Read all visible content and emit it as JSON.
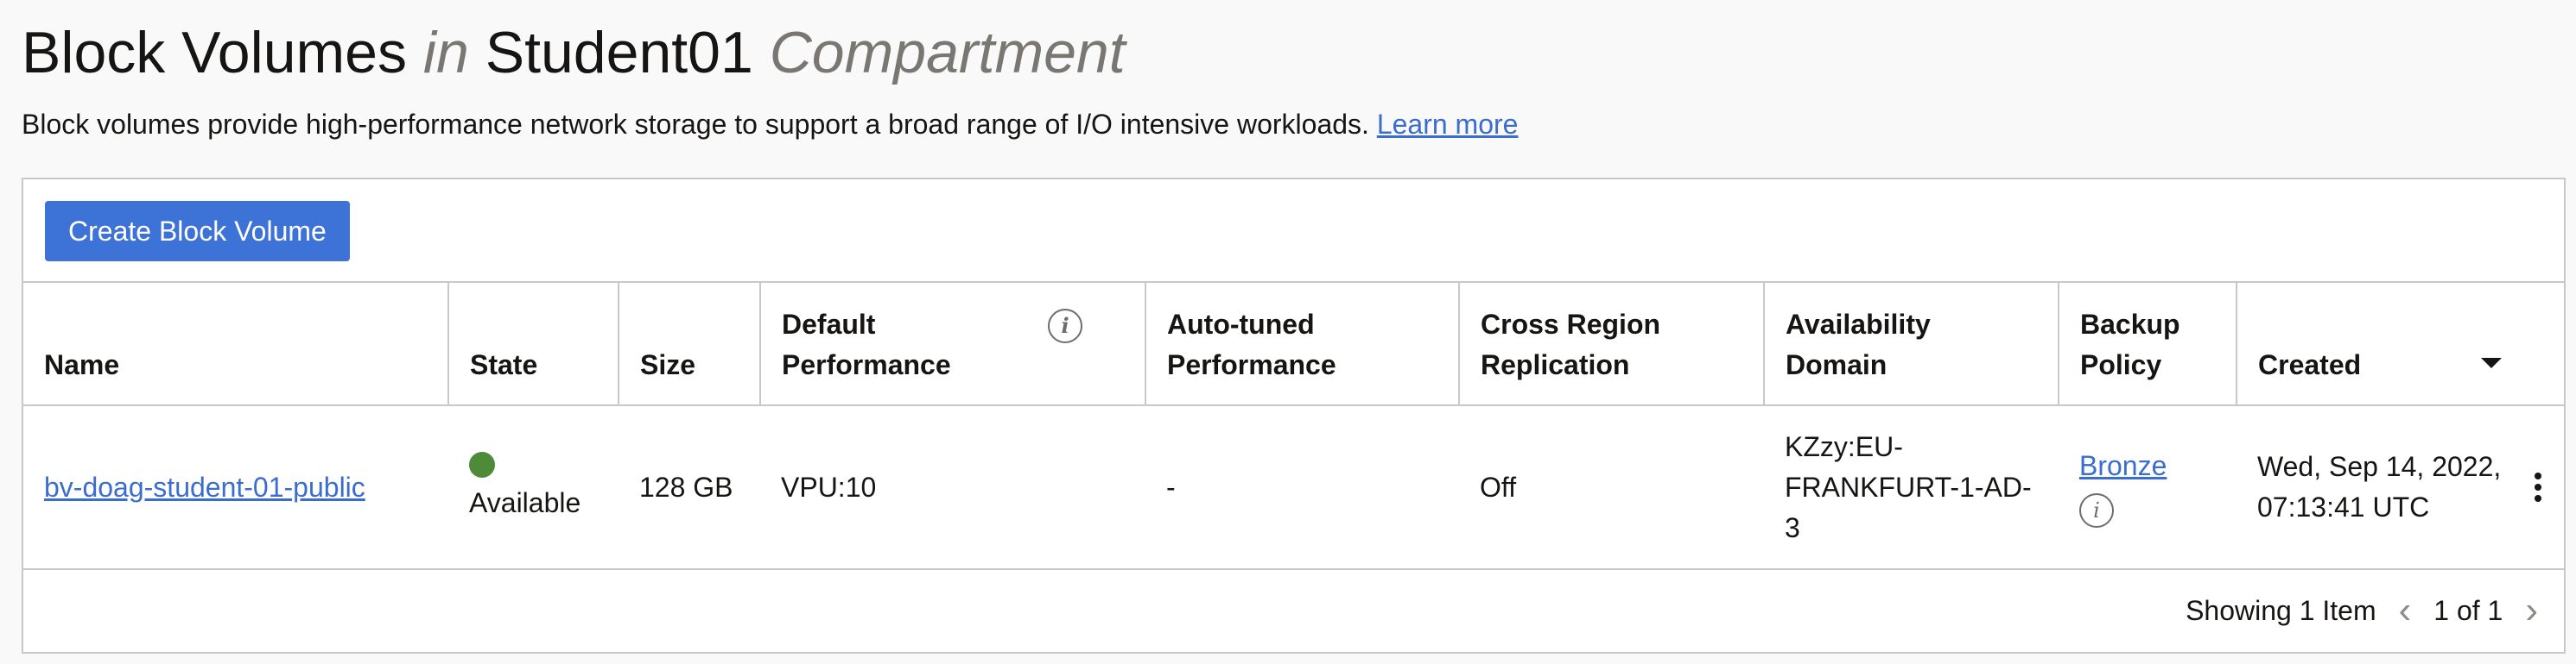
{
  "header": {
    "title_main": "Block Volumes",
    "title_in": "in",
    "compartment": "Student01",
    "compartment_suffix": "Compartment",
    "description": "Block volumes provide high-performance network storage to support a broad range of I/O intensive workloads.",
    "learn_more": "Learn more"
  },
  "toolbar": {
    "create_label": "Create Block Volume"
  },
  "table": {
    "columns": {
      "name": "Name",
      "state": "State",
      "size": "Size",
      "default_perf_1": "Default",
      "default_perf_2": "Performance",
      "auto_tuned_1": "Auto-tuned",
      "auto_tuned_2": "Performance",
      "cross_region_1": "Cross Region",
      "cross_region_2": "Replication",
      "availability_1": "Availability",
      "availability_2": "Domain",
      "backup_1": "Backup",
      "backup_2": "Policy",
      "created": "Created"
    },
    "rows": [
      {
        "name": "bv-doag-student-01-public",
        "state": "Available",
        "size": "128 GB",
        "default_performance": "VPU:10",
        "auto_tuned_performance": "-",
        "cross_region_replication": "Off",
        "availability_domain": "KZzy:EU-FRANKFURT-1-AD-3",
        "backup_policy": "Bronze",
        "created": "Wed, Sep 14, 2022, 07:13:41 UTC"
      }
    ]
  },
  "pagination": {
    "showing": "Showing 1 Item",
    "page": "1 of 1"
  },
  "icons": {
    "info": "info-icon",
    "sort": "sort-desc-icon",
    "state": "status-dot-icon",
    "actions": "kebab-menu-icon",
    "prev": "chevron-left-icon",
    "next": "chevron-right-icon"
  },
  "colors": {
    "primary_button": "#3d72d6",
    "link": "#3b6ccf",
    "available_status": "#4f8a3a"
  }
}
